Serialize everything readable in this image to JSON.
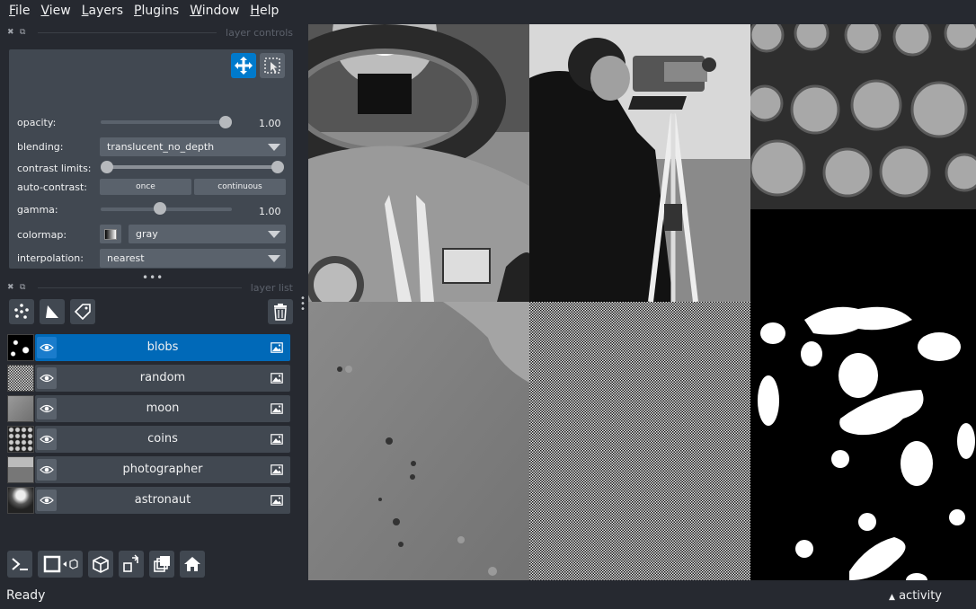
{
  "menu": [
    {
      "label": "File",
      "mnemonic": "F",
      "rest": "ile"
    },
    {
      "label": "View",
      "mnemonic": "V",
      "rest": "iew"
    },
    {
      "label": "Layers",
      "mnemonic": "L",
      "rest": "ayers"
    },
    {
      "label": "Plugins",
      "mnemonic": "P",
      "rest": "lugins"
    },
    {
      "label": "Window",
      "mnemonic": "W",
      "rest": "indow"
    },
    {
      "label": "Help",
      "mnemonic": "H",
      "rest": "elp"
    }
  ],
  "layer_controls": {
    "title": "layer controls",
    "opacity_label": "opacity:",
    "opacity_value": "1.00",
    "opacity_level": 1.0,
    "blending_label": "blending:",
    "blending_value": "translucent_no_depth",
    "contrast_label": "contrast limits:",
    "contrast_range": [
      0.0,
      1.0
    ],
    "autocontrast_label": "auto-contrast:",
    "once_label": "once",
    "continuous_label": "continuous",
    "gamma_label": "gamma:",
    "gamma_value": "1.00",
    "gamma_level": 0.5,
    "colormap_label": "colormap:",
    "colormap_value": "gray",
    "interpolation_label": "interpolation:",
    "interpolation_value": "nearest"
  },
  "layer_list": {
    "title": "layer list",
    "layers": [
      {
        "name": "blobs",
        "selected": true
      },
      {
        "name": "random",
        "selected": false
      },
      {
        "name": "moon",
        "selected": false
      },
      {
        "name": "coins",
        "selected": false
      },
      {
        "name": "photographer",
        "selected": false
      },
      {
        "name": "astronaut",
        "selected": false
      }
    ]
  },
  "status": {
    "text": "Ready",
    "activity": "activity"
  },
  "colors": {
    "background": "#262930",
    "panel": "#414851",
    "accent": "#007acc",
    "selected_row": "#0069b8"
  }
}
